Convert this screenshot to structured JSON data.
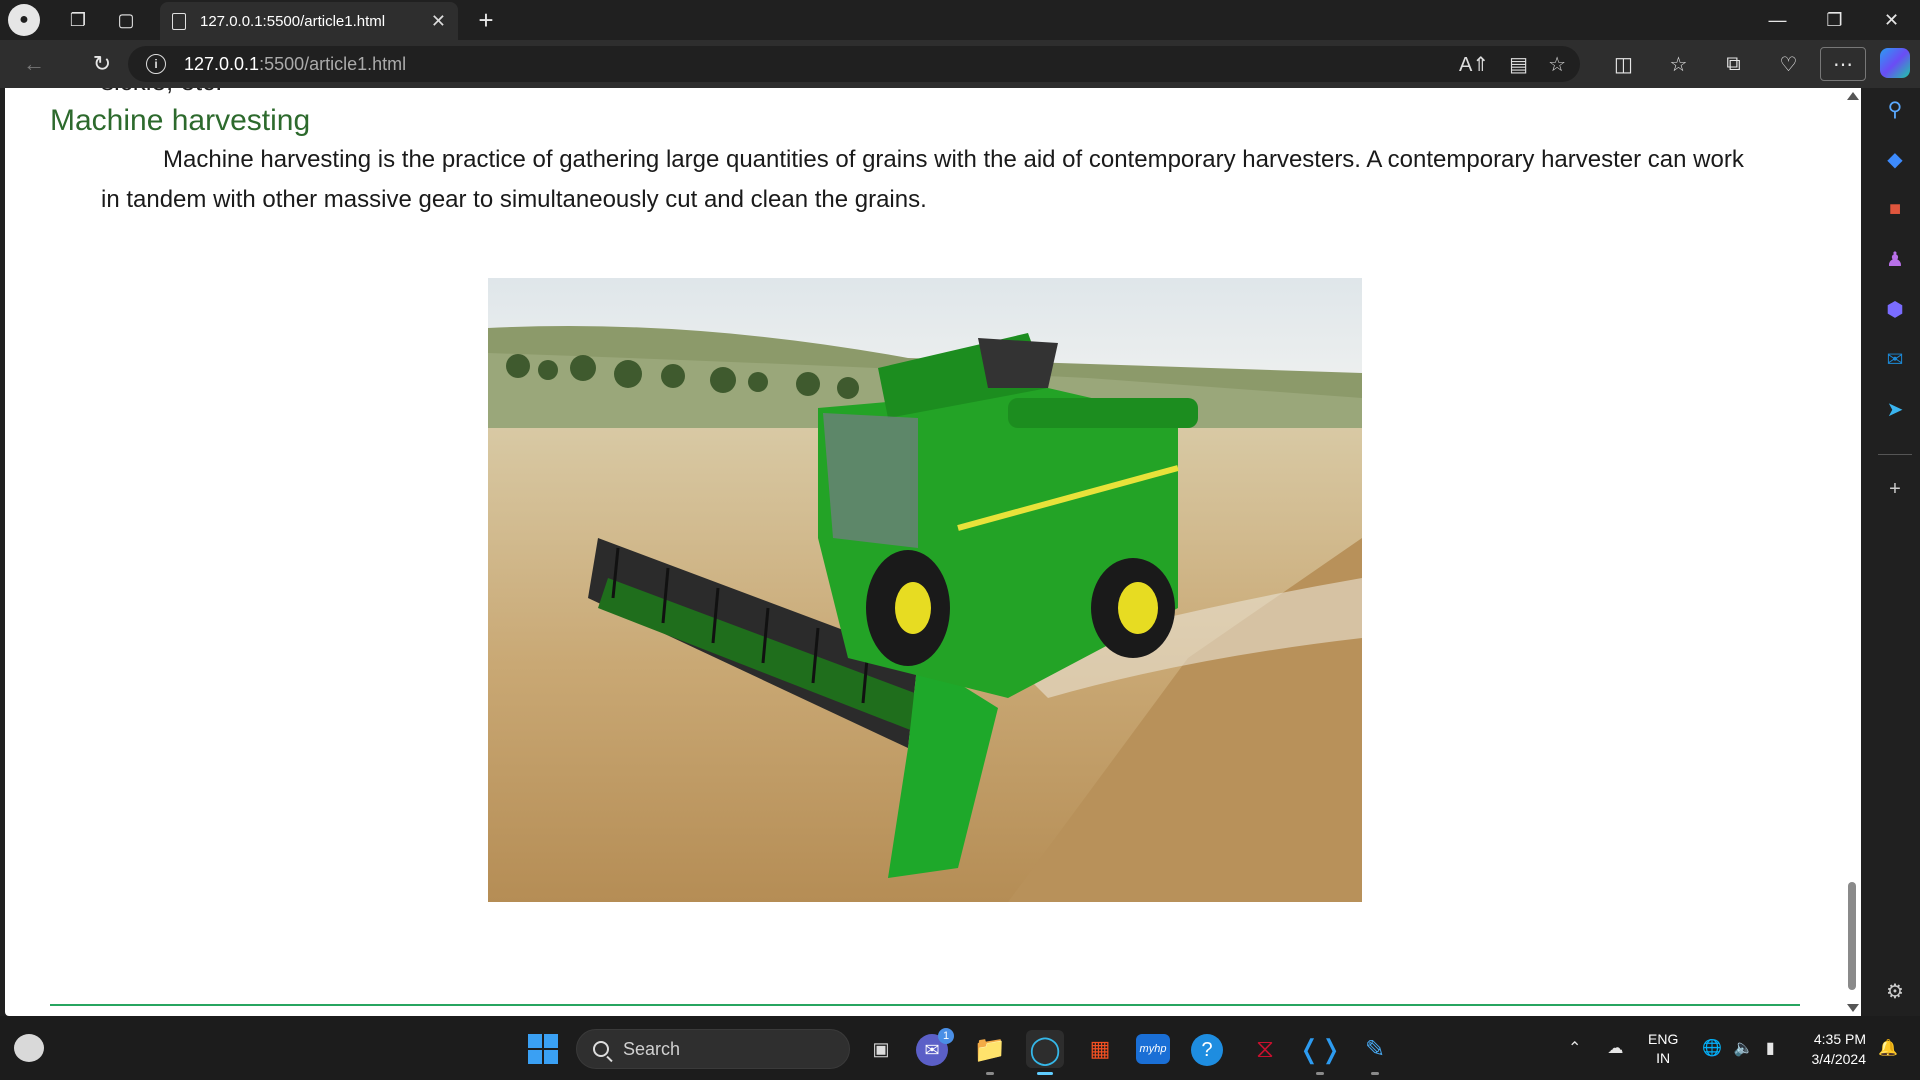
{
  "browser": {
    "tab_title": "127.0.0.1:5500/article1.html",
    "url_host": "127.0.0.1",
    "url_rest": ":5500/article1.html"
  },
  "article": {
    "cut_text": "sickle, etc.",
    "heading": "Machine harvesting",
    "paragraph": "Machine harvesting is the practice of gathering large quantities of grains with the aid of contemporary harvesters. A contemporary harvester can work in tandem with other massive gear to simultaneously cut and clean the grains."
  },
  "colors": {
    "heading": "#2d6a2d",
    "rule": "#27a560",
    "accent": "#60cdff"
  },
  "taskbar": {
    "search_label": "Search",
    "teams_badge": "1",
    "lang_line1": "ENG",
    "lang_line2": "IN",
    "time": "4:35 PM",
    "date": "3/4/2024"
  }
}
